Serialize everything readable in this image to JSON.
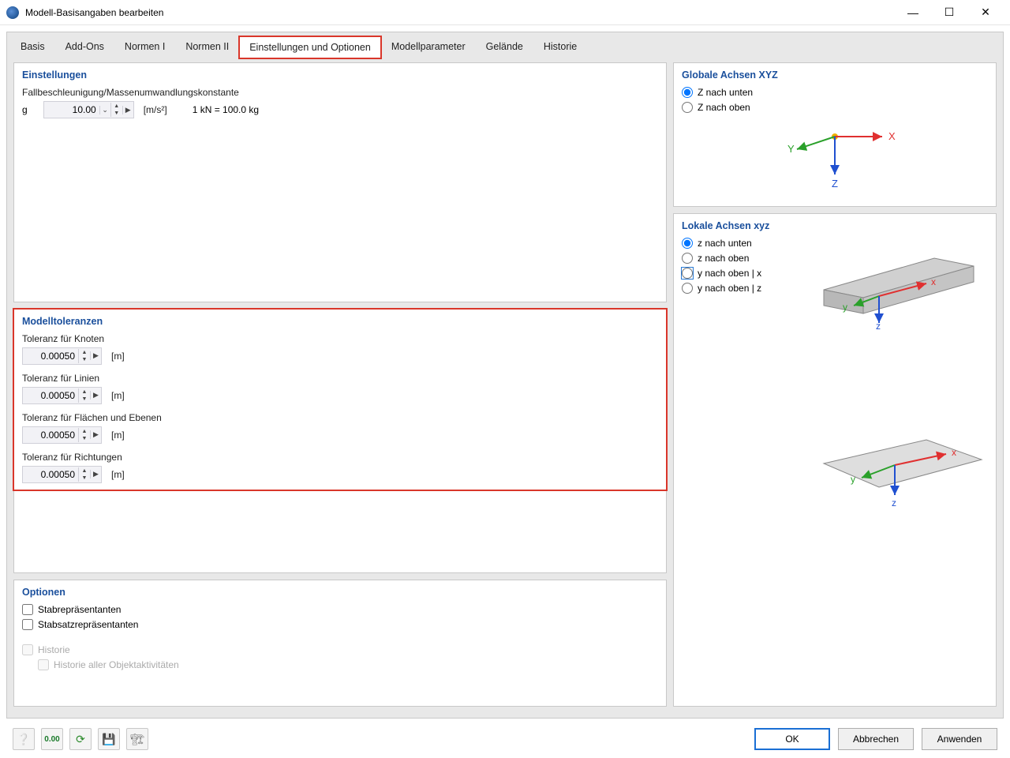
{
  "window": {
    "title": "Modell-Basisangaben bearbeiten"
  },
  "tabs": {
    "basis": "Basis",
    "addons": "Add-Ons",
    "normen1": "Normen I",
    "normen2": "Normen II",
    "einstellungen": "Einstellungen und Optionen",
    "modellparameter": "Modellparameter",
    "gelaende": "Gelände",
    "historie": "Historie"
  },
  "settings": {
    "title": "Einstellungen",
    "subtitle": "Fallbeschleunigung/Massenumwandlungskonstante",
    "g_label": "g",
    "g_value": "10.00",
    "g_unit": "[m/s²]",
    "conversion": "1 kN = 100.0 kg"
  },
  "tolerances": {
    "title": "Modelltoleranzen",
    "node_label": "Toleranz für Knoten",
    "node_value": "0.00050",
    "line_label": "Toleranz für Linien",
    "line_value": "0.00050",
    "surface_label": "Toleranz für Flächen und Ebenen",
    "surface_value": "0.00050",
    "direction_label": "Toleranz für Richtungen",
    "direction_value": "0.00050",
    "unit": "[m]"
  },
  "options": {
    "title": "Optionen",
    "stab": "Stabrepräsentanten",
    "stabsatz": "Stabsatzrepräsentanten",
    "historie": "Historie",
    "historie_all": "Historie aller Objektaktivitäten"
  },
  "global_axes": {
    "title": "Globale Achsen XYZ",
    "z_down": "Z nach unten",
    "z_up": "Z nach oben"
  },
  "local_axes": {
    "title": "Lokale Achsen xyz",
    "z_down": "z nach unten",
    "z_up": "z nach oben",
    "y_up_x": "y nach oben | x",
    "y_up_z": "y nach oben | z"
  },
  "footer": {
    "ok": "OK",
    "cancel": "Abbrechen",
    "apply": "Anwenden"
  }
}
